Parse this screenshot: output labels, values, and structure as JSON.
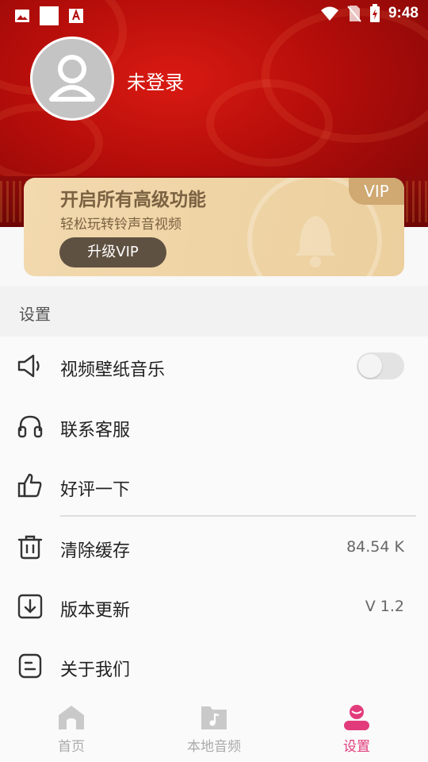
{
  "status_bar": {
    "time": "9:48"
  },
  "profile": {
    "login_text": "未登录"
  },
  "vip_card": {
    "title": "开启所有高级功能",
    "subtitle": "轻松玩转铃声音视频",
    "button": "升级VIP",
    "tag": "VIP"
  },
  "settings": {
    "section_title": "设置",
    "items": [
      {
        "label": "视频壁纸音乐",
        "icon": "speaker-icon",
        "toggle_on": false
      },
      {
        "label": "联系客服",
        "icon": "headphones-icon"
      },
      {
        "label": "好评一下",
        "icon": "thumbs-up-icon"
      },
      {
        "label": "清除缓存",
        "icon": "trash-icon",
        "value": "84.54 K"
      },
      {
        "label": "版本更新",
        "icon": "download-icon",
        "value": "V 1.2"
      },
      {
        "label": "关于我们",
        "icon": "info-doc-icon"
      }
    ]
  },
  "tabbar": {
    "tabs": [
      {
        "label": "首页",
        "icon": "home-icon",
        "active": false
      },
      {
        "label": "本地音频",
        "icon": "music-folder-icon",
        "active": false
      },
      {
        "label": "设置",
        "icon": "person-icon",
        "active": true
      }
    ]
  },
  "colors": {
    "accent": "#e23b7b",
    "hero": "#c1120d",
    "vip_card": "#efd4a6",
    "vip_button": "#5f5141"
  }
}
